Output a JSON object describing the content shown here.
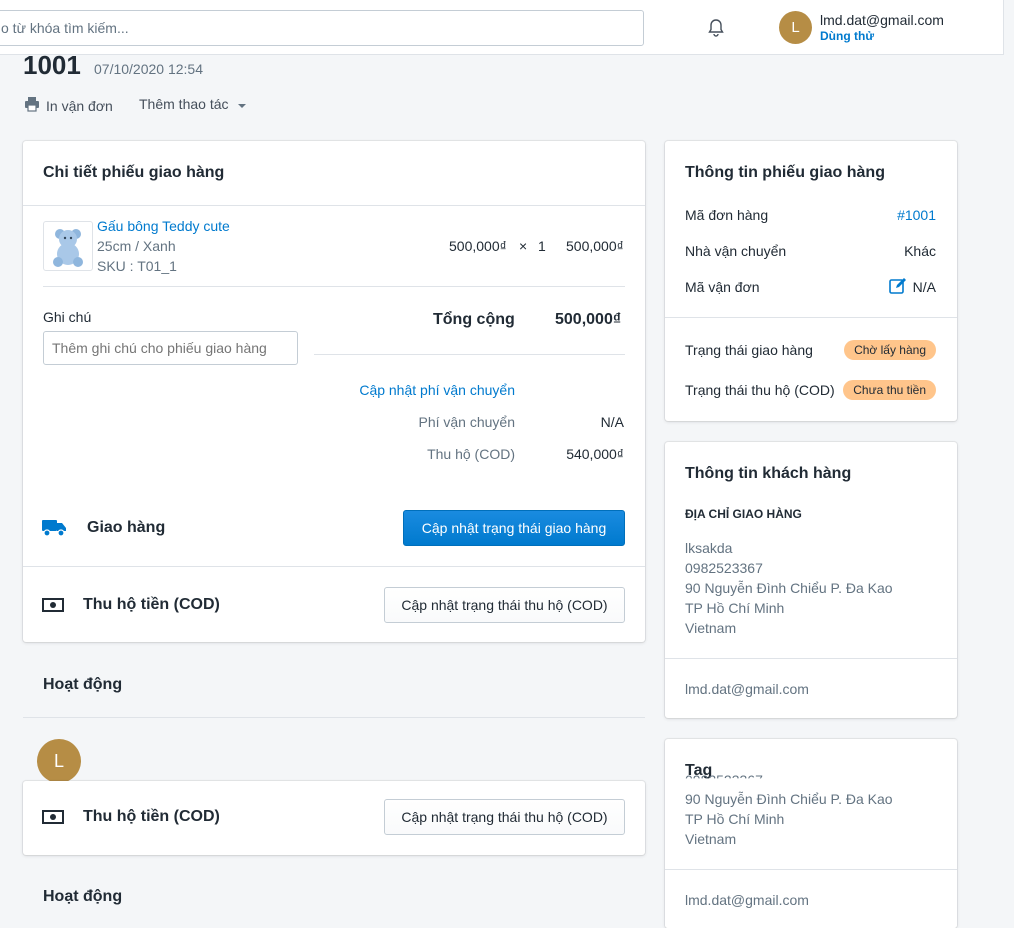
{
  "search": {
    "placeholder": "o từ khóa tìm kiếm..."
  },
  "user": {
    "initial": "L",
    "email": "lmd.dat@gmail.com",
    "plan": "Dùng thử"
  },
  "order": {
    "number": "1001",
    "date": "07/10/2020 12:54"
  },
  "actions": {
    "print": "In vận đơn",
    "more": "Thêm thao tác"
  },
  "shipment_detail": {
    "title": "Chi tiết phiếu giao hàng",
    "item": {
      "name": "Gấu bông Teddy cute",
      "variant": "25cm / Xanh",
      "sku": "SKU : T01_1",
      "price": "500,000₫",
      "times": "×",
      "qty": "1",
      "line_total": "500,000₫"
    },
    "note_label": "Ghi chú",
    "note_placeholder": "Thêm ghi chú cho phiếu giao hàng",
    "total_label": "Tổng cộng",
    "total_value": "500,000₫",
    "update_fee_link": "Cập nhật phí vận chuyển",
    "fee_label": "Phí vận chuyển",
    "fee_value": "N/A",
    "cod_label": "Thu hộ (COD)",
    "cod_value": "540,000₫",
    "delivery_label": "Giao hàng",
    "delivery_button": "Cập nhật trạng thái giao hàng",
    "cod_section_label": "Thu hộ tiền (COD)",
    "cod_button": "Cập nhật trạng thái thu hộ (COD)"
  },
  "activity": {
    "title": "Hoạt động",
    "avatar": "L"
  },
  "shipment_info": {
    "title": "Thông tin phiếu giao hàng",
    "order_code_label": "Mã đơn hàng",
    "order_code_value": "#1001",
    "carrier_label": "Nhà vận chuyển",
    "carrier_value": "Khác",
    "tracking_label": "Mã vận đơn",
    "tracking_value": "N/A",
    "delivery_status_label": "Trạng thái giao hàng",
    "delivery_status_value": "Chờ lấy hàng",
    "cod_status_label": "Trạng thái thu hộ (COD)",
    "cod_status_value": "Chưa thu tiền"
  },
  "customer": {
    "title": "Thông tin khách hàng",
    "address_heading": "ĐỊA CHỈ GIAO HÀNG",
    "name": "lksakda",
    "phone": "0982523367",
    "street": "90 Nguyễn Đình Chiểu P. Đa Kao",
    "city": "TP Hồ Chí Minh",
    "country": "Vietnam",
    "email": "lmd.dat@gmail.com"
  },
  "tag": {
    "title": "Tag"
  },
  "colors": {
    "accent": "#007ace",
    "badge": "#ffc58b",
    "avatar": "#b68d45"
  }
}
